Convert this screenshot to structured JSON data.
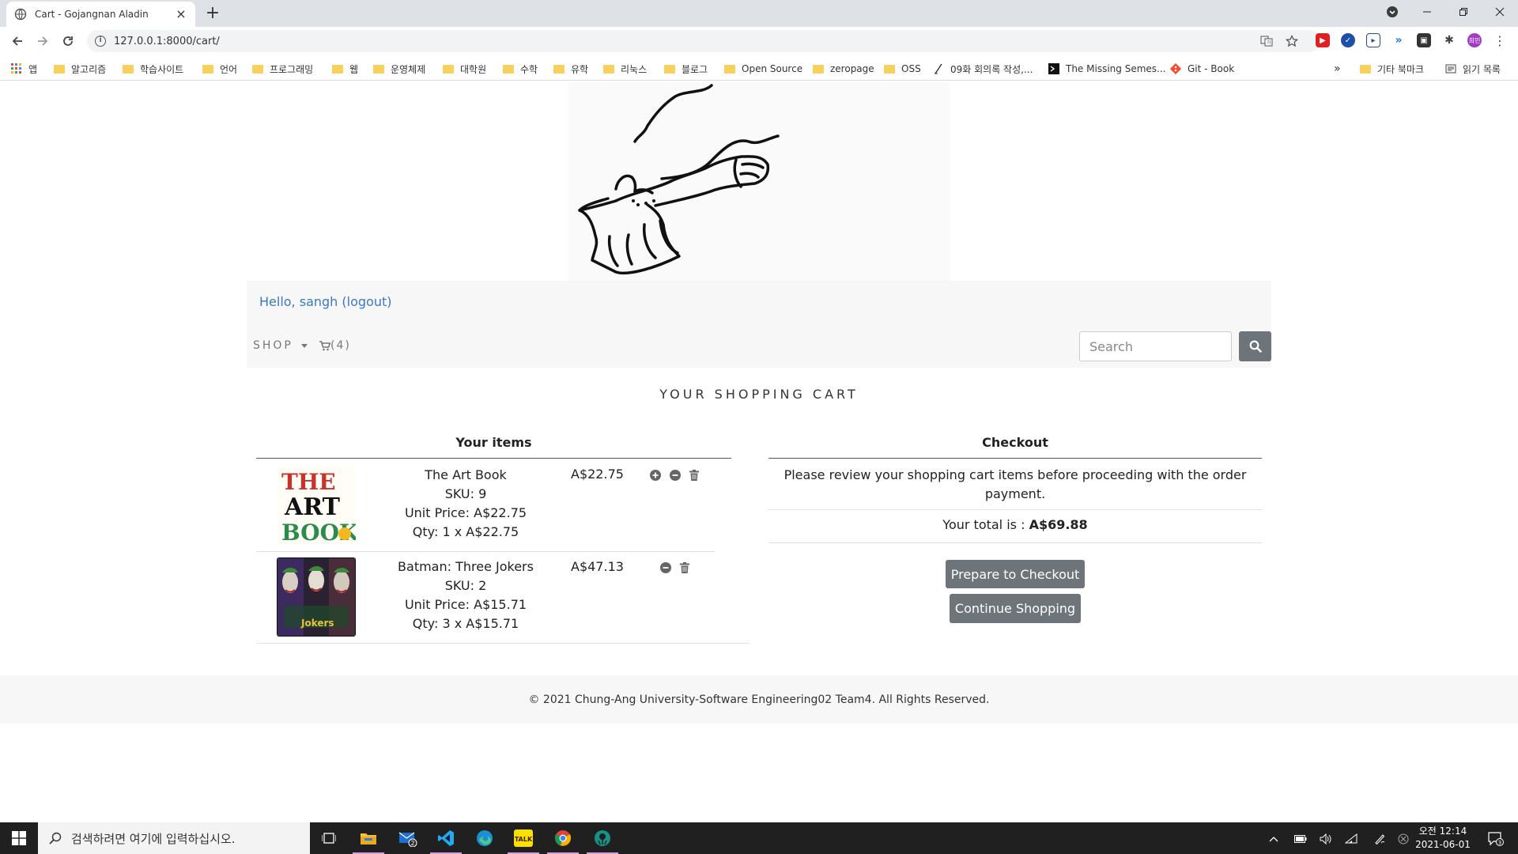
{
  "browser": {
    "tab_title": "Cart - Gojangnan Aladin",
    "tab_close": "×",
    "new_tab": "+",
    "url": "127.0.0.1:8000/cart/",
    "bookmarks": [
      {
        "label": "앱",
        "icon": "apps-grid-icon"
      },
      {
        "label": "알고리즘",
        "icon": "folder-icon"
      },
      {
        "label": "학습사이트",
        "icon": "folder-icon"
      },
      {
        "label": "언어",
        "icon": "folder-icon"
      },
      {
        "label": "프로그래밍",
        "icon": "folder-icon"
      },
      {
        "label": "웹",
        "icon": "folder-icon"
      },
      {
        "label": "운영체제",
        "icon": "folder-icon"
      },
      {
        "label": "대학원",
        "icon": "folder-icon"
      },
      {
        "label": "수학",
        "icon": "folder-icon"
      },
      {
        "label": "유학",
        "icon": "folder-icon"
      },
      {
        "label": "리눅스",
        "icon": "folder-icon"
      },
      {
        "label": "블로그",
        "icon": "folder-icon"
      },
      {
        "label": "Open Source",
        "icon": "folder-icon"
      },
      {
        "label": "zeropage",
        "icon": "folder-icon"
      },
      {
        "label": "OSS",
        "icon": "folder-icon"
      },
      {
        "label": "09화 회의록 작성,...",
        "icon": "pen-icon"
      },
      {
        "label": "The Missing Semes...",
        "icon": "terminal-icon"
      },
      {
        "label": "Git - Book",
        "icon": "git-icon"
      }
    ],
    "overflow": "»",
    "other_bookmarks": "기타 북마크",
    "reading_list": "읽기 목록"
  },
  "header": {
    "greeting": "Hello, sangh (logout)",
    "shop_label": "SHOP",
    "cart_count": "(4)",
    "search_placeholder": "Search"
  },
  "cart": {
    "title": "YOUR SHOPPING CART",
    "items_heading": "Your items",
    "items": [
      {
        "name": "The Art Book",
        "sku": "SKU: 9",
        "unit_price": "Unit Price: A$22.75",
        "qty": "Qty: 1 x A$22.75",
        "total": "A$22.75",
        "cover": {
          "line1": "THE",
          "line2": "ART",
          "line3": "BOOK"
        }
      },
      {
        "name": "Batman: Three Jokers",
        "sku": "SKU: 2",
        "unit_price": "Unit Price: A$15.71",
        "qty": "Qty: 3 x A$15.71",
        "total": "A$47.13",
        "cover": {
          "line1": "Jokers"
        }
      }
    ]
  },
  "checkout": {
    "heading": "Checkout",
    "message": "Please review your shopping cart items before proceeding with the order payment.",
    "total_label": "Your total is : ",
    "total_value": "A$69.88",
    "prepare_button": "Prepare to Checkout",
    "continue_button": "Continue Shopping"
  },
  "footer": {
    "text": "© 2021 Chung-Ang University-Software Engineering02 Team4. All Rights Reserved."
  },
  "taskbar": {
    "search_placeholder": "검색하려면 여기에 입력하십시오.",
    "mail_badge": "2",
    "time": "오전 12:14",
    "date": "2021-06-01",
    "notification_count": "3",
    "kakao_label": "TALK"
  },
  "colors": {
    "link": "#3a78c4",
    "button": "#6d747a",
    "navbar_bg": "#f7f7f7"
  }
}
